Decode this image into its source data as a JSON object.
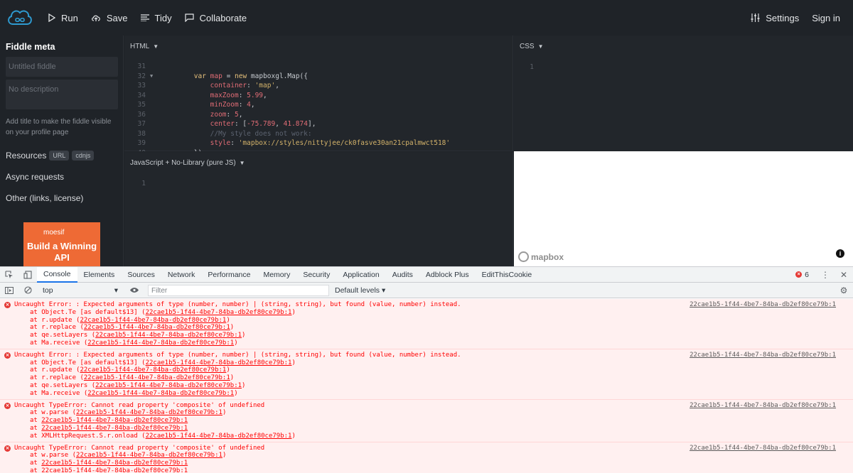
{
  "topbar": {
    "run": "Run",
    "save": "Save",
    "tidy": "Tidy",
    "collaborate": "Collaborate",
    "settings": "Settings",
    "signin": "Sign in"
  },
  "sidebar": {
    "title": "Fiddle meta",
    "title_placeholder": "Untitled fiddle",
    "desc_placeholder": "No description",
    "hint": "Add title to make the fiddle visible on your profile page",
    "resources": "Resources",
    "chip_url": "URL",
    "chip_cdnjs": "cdnjs",
    "async": "Async requests",
    "other": "Other (links, license)",
    "ad_brand": "moesif",
    "ad_headline": "Build a Winning API"
  },
  "panels": {
    "html_label": "HTML",
    "css_label": "CSS",
    "js_label": "JavaScript + No-Library (pure JS)",
    "css_line": "1",
    "js_line": "1"
  },
  "html_code": [
    {
      "n": "31",
      "fold": "",
      "t": ""
    },
    {
      "n": "32",
      "fold": "▼",
      "t": "        var map = new mapboxgl.Map({"
    },
    {
      "n": "33",
      "fold": "",
      "t": "            container: 'map',"
    },
    {
      "n": "34",
      "fold": "",
      "t": "            maxZoom: 5.99,"
    },
    {
      "n": "35",
      "fold": "",
      "t": "            minZoom: 4,"
    },
    {
      "n": "36",
      "fold": "",
      "t": "            zoom: 5,"
    },
    {
      "n": "37",
      "fold": "",
      "t": "            center: [-75.789, 41.874],"
    },
    {
      "n": "38",
      "fold": "",
      "t": "            //My style does not work:"
    },
    {
      "n": "39",
      "fold": "",
      "t": "            style: 'mapbox://styles/nittyjee/ck0fasve30an21cpalmwct518'"
    },
    {
      "n": "40",
      "fold": "",
      "t": "        });"
    }
  ],
  "result": {
    "mapbox": "mapbox",
    "info": "i"
  },
  "devtools": {
    "tabs": [
      "Console",
      "Elements",
      "Sources",
      "Network",
      "Performance",
      "Memory",
      "Security",
      "Application",
      "Audits",
      "Adblock Plus",
      "EditThisCookie"
    ],
    "error_count": "6",
    "context": "top",
    "filter_placeholder": "Filter",
    "levels": "Default levels ▾"
  },
  "console": [
    {
      "first": "Uncaught Error: : Expected arguments of type (number, number) | (string, string), but found (value, number) instead.",
      "src": "22cae1b5-1f44-4be7-84ba-db2ef80ce79b:1",
      "trace": [
        {
          "pre": "at Object.Te [as default$13] (",
          "link": "22cae1b5-1f44-4be7-84ba-db2ef80ce79b:1",
          "post": ")"
        },
        {
          "pre": "at r.update (",
          "link": "22cae1b5-1f44-4be7-84ba-db2ef80ce79b:1",
          "post": ")"
        },
        {
          "pre": "at r.replace (",
          "link": "22cae1b5-1f44-4be7-84ba-db2ef80ce79b:1",
          "post": ")"
        },
        {
          "pre": "at qe.setLayers (",
          "link": "22cae1b5-1f44-4be7-84ba-db2ef80ce79b:1",
          "post": ")"
        },
        {
          "pre": "at Ma.receive (",
          "link": "22cae1b5-1f44-4be7-84ba-db2ef80ce79b:1",
          "post": ")"
        }
      ]
    },
    {
      "first": "Uncaught Error: : Expected arguments of type (number, number) | (string, string), but found (value, number) instead.",
      "src": "22cae1b5-1f44-4be7-84ba-db2ef80ce79b:1",
      "trace": [
        {
          "pre": "at Object.Te [as default$13] (",
          "link": "22cae1b5-1f44-4be7-84ba-db2ef80ce79b:1",
          "post": ")"
        },
        {
          "pre": "at r.update (",
          "link": "22cae1b5-1f44-4be7-84ba-db2ef80ce79b:1",
          "post": ")"
        },
        {
          "pre": "at r.replace (",
          "link": "22cae1b5-1f44-4be7-84ba-db2ef80ce79b:1",
          "post": ")"
        },
        {
          "pre": "at qe.setLayers (",
          "link": "22cae1b5-1f44-4be7-84ba-db2ef80ce79b:1",
          "post": ")"
        },
        {
          "pre": "at Ma.receive (",
          "link": "22cae1b5-1f44-4be7-84ba-db2ef80ce79b:1",
          "post": ")"
        }
      ]
    },
    {
      "first": "Uncaught TypeError: Cannot read property 'composite' of undefined",
      "src": "22cae1b5-1f44-4be7-84ba-db2ef80ce79b:1",
      "trace": [
        {
          "pre": "at w.parse (",
          "link": "22cae1b5-1f44-4be7-84ba-db2ef80ce79b:1",
          "post": ")"
        },
        {
          "pre": "at ",
          "link": "22cae1b5-1f44-4be7-84ba-db2ef80ce79b:1",
          "post": ""
        },
        {
          "pre": "at ",
          "link": "22cae1b5-1f44-4be7-84ba-db2ef80ce79b:1",
          "post": ""
        },
        {
          "pre": "at XMLHttpRequest.S.r.onload (",
          "link": "22cae1b5-1f44-4be7-84ba-db2ef80ce79b:1",
          "post": ")"
        }
      ]
    },
    {
      "first": "Uncaught TypeError: Cannot read property 'composite' of undefined",
      "src": "22cae1b5-1f44-4be7-84ba-db2ef80ce79b:1",
      "trace": [
        {
          "pre": "at w.parse (",
          "link": "22cae1b5-1f44-4be7-84ba-db2ef80ce79b:1",
          "post": ")"
        },
        {
          "pre": "at ",
          "link": "22cae1b5-1f44-4be7-84ba-db2ef80ce79b:1",
          "post": ""
        },
        {
          "pre": "at ",
          "link": "22cae1b5-1f44-4be7-84ba-db2ef80ce79b:1",
          "post": ""
        }
      ]
    }
  ]
}
